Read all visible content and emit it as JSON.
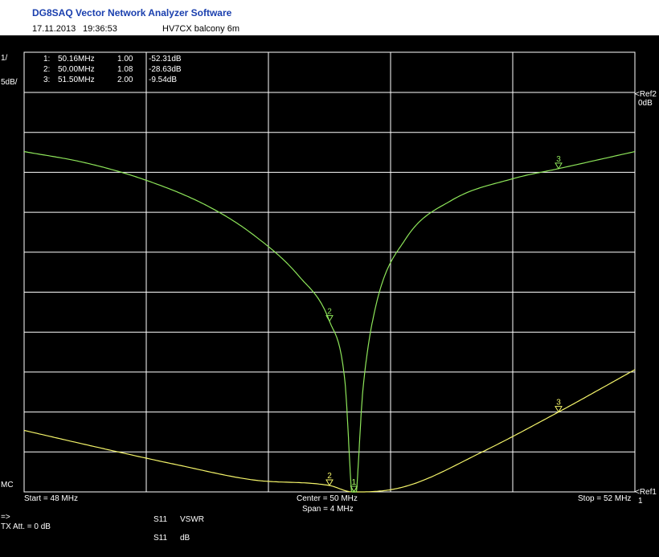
{
  "header": {
    "title": "DG8SAQ Vector Network Analyzer Software",
    "date": "17.11.2013",
    "time": "19:36:53",
    "label": "HV7CX balcony 6m"
  },
  "scale": {
    "top_left": "1/",
    "top_left2": "5dB/",
    "bottom_left": "MC",
    "ref2": "<Ref2",
    "ref2_value": "0dB",
    "ref1": "<Ref1",
    "ref1_value": "1"
  },
  "markers": [
    {
      "id": "1:",
      "freq": "50.16MHz",
      "vswr": "1.00",
      "db": "-52.31dB"
    },
    {
      "id": "2:",
      "freq": "50.00MHz",
      "vswr": "1.08",
      "db": "-28.63dB"
    },
    {
      "id": "3:",
      "freq": "51.50MHz",
      "vswr": "2.00",
      "db": "-9.54dB"
    }
  ],
  "footer": {
    "start": "Start = 48 MHz",
    "center": "Center = 50 MHz",
    "span": "Span = 4 MHz",
    "stop": "Stop = 52 MHz",
    "arrow": "=>",
    "tx_att": "TX Att.  = 0 dB",
    "trace1_param": "S11",
    "trace1_format": "VSWR",
    "trace2_param": "S11",
    "trace2_format": "dB"
  },
  "colors": {
    "background": "#000000",
    "grid": "#ffffff",
    "vswr_trace": "#f5f56a",
    "db_trace": "#8ee65a"
  },
  "chart_data": {
    "type": "line",
    "x_range": [
      48,
      52
    ],
    "x_unit": "MHz",
    "grid": true,
    "series": [
      {
        "name": "S11 VSWR",
        "y_range": [
          1,
          6
        ],
        "x": [
          48.0,
          48.5,
          49.0,
          49.5,
          50.0,
          50.15,
          50.2,
          50.5,
          51.0,
          51.5,
          52.0
        ],
        "y": [
          1.77,
          1.55,
          1.34,
          1.15,
          1.08,
          1.0,
          1.0,
          1.07,
          1.5,
          2.0,
          2.53
        ]
      },
      {
        "name": "S11 dB",
        "y_range": [
          -50,
          0
        ],
        "x": [
          48.0,
          48.4,
          48.8,
          49.2,
          49.5,
          49.8,
          50.0,
          50.1,
          50.16,
          50.22,
          50.3,
          50.5,
          50.8,
          51.2,
          51.5,
          52.0
        ],
        "y": [
          -7.4,
          -8.8,
          -11.0,
          -14.2,
          -17.8,
          -23.0,
          -28.63,
          -36.0,
          -52.31,
          -37.0,
          -27.0,
          -18.3,
          -13.5,
          -10.8,
          -9.54,
          -7.4
        ]
      }
    ],
    "marker_labels": [
      "1",
      "2",
      "3"
    ],
    "marker_x": [
      50.16,
      50.0,
      51.5
    ]
  }
}
